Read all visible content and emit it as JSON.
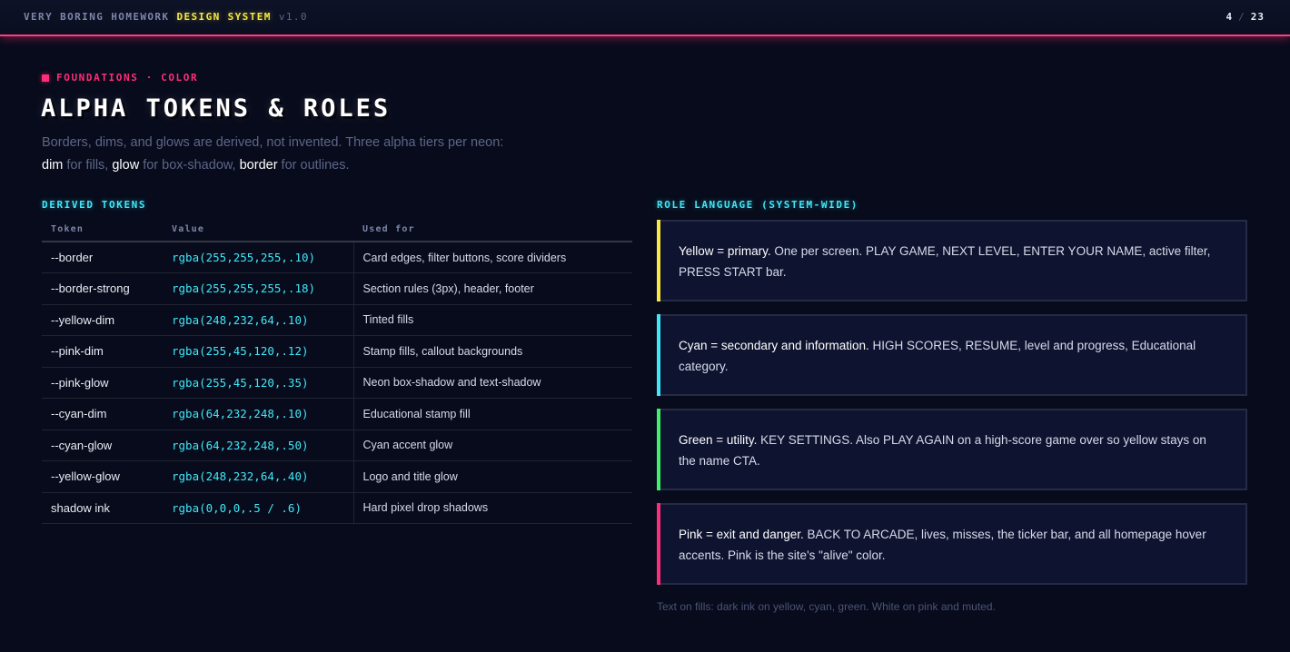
{
  "header": {
    "brand_prefix": "VERY BORING HOMEWORK",
    "brand_accent": "DESIGN SYSTEM",
    "version": "v1.0",
    "page_current": "4",
    "page_total": "23"
  },
  "eyebrow": "FOUNDATIONS · COLOR",
  "title": "ALPHA TOKENS & ROLES",
  "lede": {
    "line1": "Borders, dims, and glows are derived, not invented. Three alpha tiers per neon:",
    "kw1": "dim",
    "t1": " for fills, ",
    "kw2": "glow",
    "t2": " for box-shadow, ",
    "kw3": "border",
    "t3": " for outlines."
  },
  "derived": {
    "heading": "DERIVED TOKENS",
    "columns": [
      "Token",
      "Value",
      "Used for"
    ],
    "rows": [
      {
        "token": "--border",
        "value": "rgba(255,255,255,.10)",
        "use": "Card edges, filter buttons, score dividers"
      },
      {
        "token": "--border-strong",
        "value": "rgba(255,255,255,.18)",
        "use": "Section rules (3px), header, footer"
      },
      {
        "token": "--yellow-dim",
        "value": "rgba(248,232,64,.10)",
        "use": "Tinted fills"
      },
      {
        "token": "--pink-dim",
        "value": "rgba(255,45,120,.12)",
        "use": "Stamp fills, callout backgrounds"
      },
      {
        "token": "--pink-glow",
        "value": "rgba(255,45,120,.35)",
        "use": "Neon box-shadow and text-shadow"
      },
      {
        "token": "--cyan-dim",
        "value": "rgba(64,232,248,.10)",
        "use": "Educational stamp fill"
      },
      {
        "token": "--cyan-glow",
        "value": "rgba(64,232,248,.50)",
        "use": "Cyan accent glow"
      },
      {
        "token": "--yellow-glow",
        "value": "rgba(248,232,64,.40)",
        "use": "Logo and title glow"
      },
      {
        "token": "shadow ink",
        "value": "rgba(0,0,0,.5 / .6)",
        "use": "Hard pixel drop shadows"
      }
    ]
  },
  "roles": {
    "heading": "ROLE LANGUAGE (SYSTEM-WIDE)",
    "cards": [
      {
        "lead": "Yellow = primary.",
        "body": " One per screen. PLAY GAME, NEXT LEVEL, ENTER YOUR NAME, active filter, PRESS START bar."
      },
      {
        "lead": "Cyan = secondary and information.",
        "body": " HIGH SCORES, RESUME, level and progress, Educational category."
      },
      {
        "lead": "Green = utility.",
        "body": " KEY SETTINGS. Also PLAY AGAIN on a high-score game over so yellow stays on the name CTA."
      },
      {
        "lead": "Pink = exit and danger.",
        "body": " BACK TO ARCADE, lives, misses, the ticker bar, and all homepage hover accents. Pink is the site's \"alive\" color."
      }
    ],
    "footnote": "Text on fills: dark ink on yellow, cyan, green. White on pink and muted."
  },
  "colors": {
    "yellow": "#f8e840",
    "cyan": "#40e8f8",
    "green": "#3ef06a",
    "pink": "#ff2d78",
    "background": "#070b1b"
  }
}
